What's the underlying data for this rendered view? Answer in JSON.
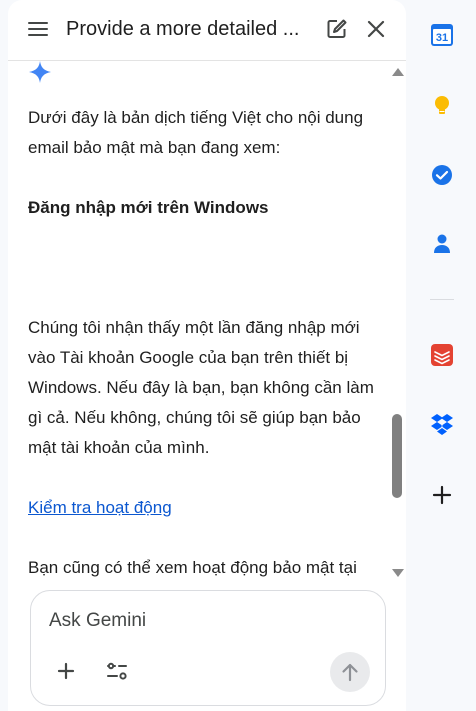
{
  "panel": {
    "title": "Provide a more detailed ...",
    "paragraphs": {
      "intro": "Dưới đây là bản dịch tiếng Việt cho nội dung email bảo mật mà bạn đang xem:",
      "heading": "Đăng nhập mới trên Windows",
      "body": "Chúng tôi nhận thấy một lần đăng nhập mới vào Tài khoản Google của bạn trên thiết bị Windows. Nếu đây là bạn, bạn không cần làm gì cả. Nếu không, chúng tôi sẽ giúp bạn bảo mật tài khoản của mình.",
      "link": "Kiểm tra hoạt động",
      "more": "Bạn cũng có thể xem hoạt động bảo mật tại"
    },
    "composer": {
      "placeholder": "Ask Gemini"
    },
    "icons": {
      "menu": "hamburger-menu-icon",
      "new_chat": "edit-icon",
      "close": "close-icon",
      "spark": "gemini-sparkle-icon",
      "add": "plus-icon",
      "tools": "tune-icon",
      "send": "arrow-up-icon"
    },
    "colors": {
      "link": "#0b57d0",
      "spark": "#4285f4"
    }
  },
  "rail": {
    "calendar_day": "31",
    "icons": [
      "calendar-icon",
      "keep-icon",
      "tasks-icon",
      "contacts-icon",
      "todoist-icon",
      "dropbox-icon",
      "add-addon-icon"
    ]
  }
}
